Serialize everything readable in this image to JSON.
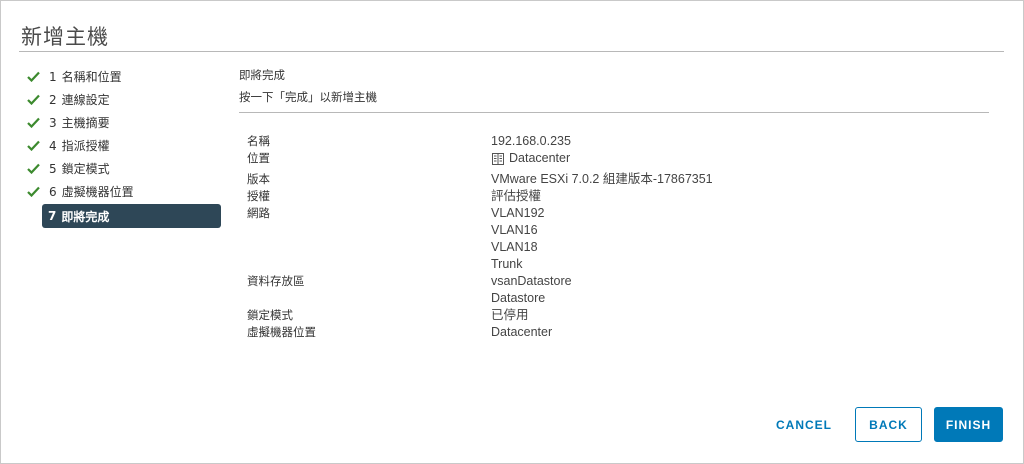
{
  "dialog": {
    "title": "新增主機"
  },
  "steps": [
    {
      "number": "1",
      "label": "名稱和位置",
      "status": "done"
    },
    {
      "number": "2",
      "label": "連線設定",
      "status": "done"
    },
    {
      "number": "3",
      "label": "主機摘要",
      "status": "done"
    },
    {
      "number": "4",
      "label": "指派授權",
      "status": "done"
    },
    {
      "number": "5",
      "label": "鎖定模式",
      "status": "done"
    },
    {
      "number": "6",
      "label": "虛擬機器位置",
      "status": "done"
    },
    {
      "number": "7",
      "label": "即將完成",
      "status": "active"
    }
  ],
  "content": {
    "heading": "即將完成",
    "subheading": "按一下「完成」以新增主機"
  },
  "summary": {
    "name_label": "名稱",
    "name_value": "192.168.0.235",
    "location_label": "位置",
    "location_value": "Datacenter",
    "version_label": "版本",
    "version_value": "VMware ESXi 7.0.2 組建版本-17867351",
    "license_label": "授權",
    "license_value": "評估授權",
    "network_label": "網路",
    "network_values": [
      "VLAN192",
      "VLAN16",
      "VLAN18",
      "Trunk"
    ],
    "datastore_label": "資料存放區",
    "datastore_values": [
      "vsanDatastore",
      "Datastore"
    ],
    "lockdown_label": "鎖定模式",
    "lockdown_value": "已停用",
    "vm_location_label": "虛擬機器位置",
    "vm_location_value": "Datacenter"
  },
  "buttons": {
    "cancel": "CANCEL",
    "back": "BACK",
    "finish": "FINISH"
  },
  "colors": {
    "check": "#3c8a2e",
    "active_step_bg": "#2e4757",
    "primary": "#0079b8"
  },
  "icons": {
    "step_done": "checkmark-icon",
    "datacenter": "datacenter-icon"
  }
}
